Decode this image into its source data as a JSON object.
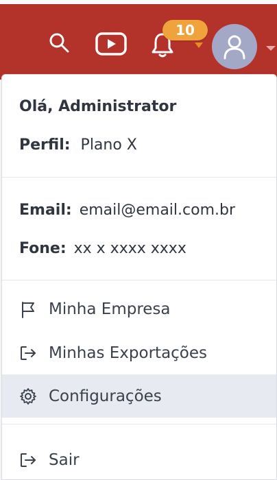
{
  "header": {
    "notification_count": "10",
    "colors": {
      "bar": "#b3322a",
      "badge": "#f0a33a",
      "avatar": "#a3a8c7"
    }
  },
  "menu": {
    "greeting": "Olá, Administrator",
    "profile_label": "Perfil:",
    "profile_value": "Plano X",
    "email_label": "Email:",
    "email_value": "email@email.com.br",
    "phone_label": "Fone:",
    "phone_value": "xx x xxxx xxxx",
    "items": [
      {
        "label": "Minha Empresa",
        "icon": "flag-icon"
      },
      {
        "label": "Minhas Exportações",
        "icon": "export-icon"
      },
      {
        "label": "Configurações",
        "icon": "gear-icon"
      },
      {
        "label": "Sair",
        "icon": "logout-icon"
      }
    ]
  }
}
